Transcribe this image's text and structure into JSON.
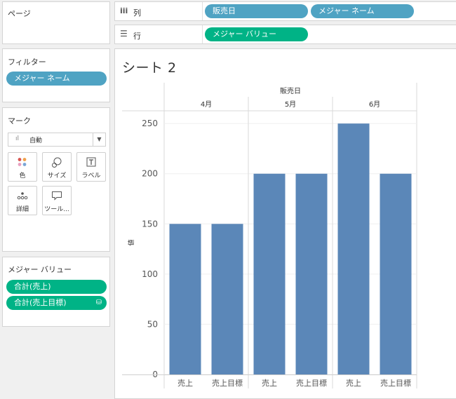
{
  "pages_panel": {
    "title": "ページ"
  },
  "columns_shelf": {
    "label": "列",
    "pills": [
      "販売日",
      "メジャー ネーム"
    ]
  },
  "rows_shelf": {
    "label": "行",
    "pills": [
      "メジャー バリュー"
    ]
  },
  "filters_panel": {
    "title": "フィルター",
    "pills": [
      "メジャー ネーム"
    ]
  },
  "marks_panel": {
    "title": "マーク",
    "mark_type": "自動",
    "buttons": [
      {
        "label": "色",
        "icon": "color-icon"
      },
      {
        "label": "サイズ",
        "icon": "size-icon"
      },
      {
        "label": "ラベル",
        "icon": "label-icon"
      },
      {
        "label": "詳細",
        "icon": "detail-icon"
      },
      {
        "label": "ツール...",
        "icon": "tooltip-icon"
      }
    ]
  },
  "measure_values_panel": {
    "title": "メジャー バリュー",
    "pills": [
      "合計(売上)",
      "合計(売上目標)"
    ]
  },
  "sheet": {
    "title": "シート 2"
  },
  "colors": {
    "blue_pill": "#4fa3c3",
    "green_pill": "#00b386",
    "bar": "#5b87b8"
  },
  "chart_data": {
    "type": "bar",
    "column_header": "販売日",
    "groups": [
      {
        "name": "4月",
        "categories": [
          "売上",
          "売上目標"
        ],
        "values": [
          150,
          150
        ]
      },
      {
        "name": "5月",
        "categories": [
          "売上",
          "売上目標"
        ],
        "values": [
          200,
          200
        ]
      },
      {
        "name": "6月",
        "categories": [
          "売上",
          "売上目標"
        ],
        "values": [
          250,
          200
        ]
      }
    ],
    "ylabel": "値",
    "yticks": [
      0,
      50,
      100,
      150,
      200,
      250
    ],
    "ylim": [
      0,
      262
    ],
    "grid": true
  }
}
